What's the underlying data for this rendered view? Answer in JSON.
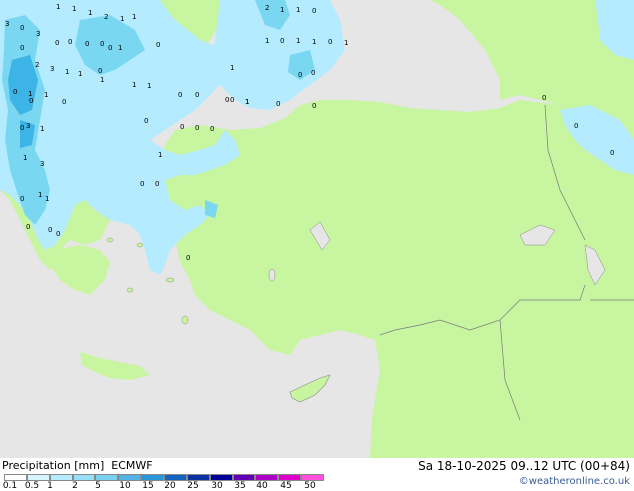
{
  "map": {
    "land_color": "#c8f5a0",
    "sea_color": "#e6e6e6",
    "precip_light_color": "#b4ebff",
    "precip_mid_color": "#7ad7f2",
    "precip_heavy_color": "#3cb4e6",
    "precip_values": [
      "3",
      "1",
      "1",
      "1",
      "1",
      "2",
      "1",
      "0",
      "3",
      "0",
      "0",
      "0",
      "0",
      "1",
      "0",
      "0",
      "0",
      "1",
      "0",
      "1",
      "2",
      "3",
      "1",
      "1",
      "0",
      "1",
      "1",
      "1",
      "0",
      "1",
      "1",
      "0",
      "0",
      "0",
      "1",
      "3",
      "0",
      "1",
      "3",
      "1",
      "0",
      "1",
      "0",
      "0",
      "0",
      "2",
      "1",
      "1",
      "0",
      "1",
      "0",
      "1",
      "1",
      "0",
      "1",
      "0",
      "0",
      "0",
      "1",
      "0",
      "0",
      "0",
      "0",
      "0",
      "0",
      "0",
      "0",
      "0",
      "0",
      "1",
      "0",
      "0",
      "0"
    ]
  },
  "footer": {
    "title": "Precipitation [mm]",
    "model": "ECMWF",
    "datetime": "Sa 18-10-2025 09..12 UTC (00+84)",
    "copyright": "©weatheronline.co.uk",
    "scale_labels": [
      "0.1",
      "0.5",
      "1",
      "2",
      "5",
      "10",
      "15",
      "20",
      "25",
      "30",
      "35",
      "40",
      "45",
      "50"
    ],
    "scale_colors": [
      "#ffffff",
      "#d7f5ff",
      "#b4ebff",
      "#96e0fa",
      "#78d2f0",
      "#50b4e6",
      "#2896d7",
      "#1464be",
      "#0a32a0",
      "#000096",
      "#6400b4",
      "#aa00c8",
      "#dc00c8",
      "#ff50dc"
    ]
  }
}
